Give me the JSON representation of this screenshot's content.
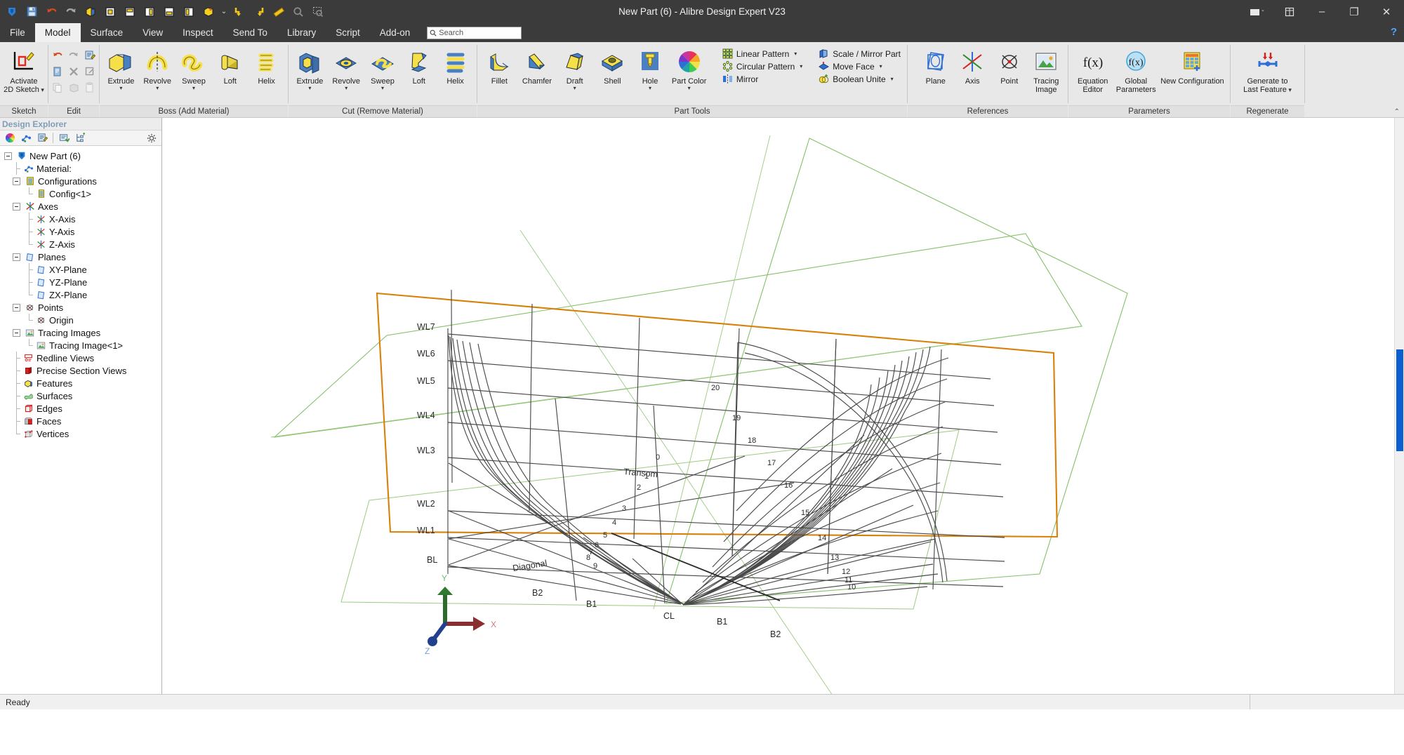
{
  "window": {
    "title": "New Part (6) - Alibre Design Expert V23",
    "controls": {
      "theme": "theme-switch",
      "restore_layout": "layout-icon",
      "minimize": "–",
      "maximize": "❐",
      "close": "✕"
    }
  },
  "quick_access": [
    {
      "name": "alibre-logo-icon",
      "glyph": "◆"
    },
    {
      "name": "save-icon",
      "glyph": "💾"
    },
    {
      "name": "undo-icon",
      "glyph": "↺"
    },
    {
      "name": "redo-icon",
      "glyph": "↻"
    },
    {
      "name": "view-iso-icon",
      "glyph": "▣"
    },
    {
      "name": "view-front-icon",
      "glyph": "▣"
    },
    {
      "name": "view-top-icon",
      "glyph": "▣"
    },
    {
      "name": "view-right-icon",
      "glyph": "▣"
    },
    {
      "name": "view-back-icon",
      "glyph": "▣"
    },
    {
      "name": "view-left-icon",
      "glyph": "▣"
    },
    {
      "name": "view-shaded-icon",
      "glyph": "▣"
    },
    {
      "name": "view-dropdown-caret",
      "glyph": "⌄"
    },
    {
      "name": "fit-in-icon",
      "glyph": "⬒"
    },
    {
      "name": "fit-out-icon",
      "glyph": "⬓"
    },
    {
      "name": "measure-icon",
      "glyph": "📏"
    },
    {
      "name": "zoom-icon",
      "glyph": "🔍"
    },
    {
      "name": "zoom-window-icon",
      "glyph": "🔎"
    }
  ],
  "menu": {
    "tabs": [
      {
        "label": "File",
        "active": false
      },
      {
        "label": "Model",
        "active": true
      },
      {
        "label": "Surface",
        "active": false
      },
      {
        "label": "View",
        "active": false
      },
      {
        "label": "Inspect",
        "active": false
      },
      {
        "label": "Send To",
        "active": false
      },
      {
        "label": "Library",
        "active": false
      },
      {
        "label": "Script",
        "active": false
      },
      {
        "label": "Add-on",
        "active": false
      }
    ],
    "search_placeholder": "Search",
    "search_value": "",
    "help_label": "?"
  },
  "ribbon": {
    "groups": [
      {
        "label": "Sketch",
        "buttons": [
          {
            "label": "Activate\n2D Sketch",
            "name": "activate-2d-sketch-button",
            "icon": "sketch-icon",
            "caret": true
          }
        ]
      },
      {
        "label": "Edit",
        "grid": [
          {
            "name": "undo-icon",
            "glyph": "↺",
            "color": "#d84a1b"
          },
          {
            "name": "redo-icon",
            "glyph": "↻",
            "color": "#a8a8a8"
          },
          {
            "name": "edit-properties-icon",
            "glyph": "▤",
            "color": "#3a6ea5"
          },
          {
            "name": "paste-special-icon",
            "glyph": "▤",
            "color": "#7fa8d4"
          },
          {
            "name": "delete-icon",
            "glyph": "✕",
            "color": "#9a9a9a"
          },
          {
            "name": "edit-definition-icon",
            "glyph": "◩",
            "color": "#9a9a9a"
          },
          {
            "name": "copy-icon",
            "glyph": "❐",
            "color": "#c8c8c8"
          },
          {
            "name": "cut-icon",
            "glyph": "◨",
            "color": "#c8c8c8"
          },
          {
            "name": "paste-icon",
            "glyph": "❒",
            "color": "#c8c8c8"
          }
        ]
      },
      {
        "label": "Boss (Add Material)",
        "buttons": [
          {
            "label": "Extrude",
            "name": "boss-extrude-button",
            "icon": "extrude-boss-icon",
            "caret": true
          },
          {
            "label": "Revolve",
            "name": "boss-revolve-button",
            "icon": "revolve-boss-icon",
            "caret": true
          },
          {
            "label": "Sweep",
            "name": "boss-sweep-button",
            "icon": "sweep-boss-icon",
            "caret": true
          },
          {
            "label": "Loft",
            "name": "boss-loft-button",
            "icon": "loft-boss-icon",
            "caret": false
          },
          {
            "label": "Helix",
            "name": "boss-helix-button",
            "icon": "helix-boss-icon",
            "caret": false
          }
        ]
      },
      {
        "label": "Cut (Remove Material)",
        "buttons": [
          {
            "label": "Extrude",
            "name": "cut-extrude-button",
            "icon": "extrude-cut-icon",
            "caret": true
          },
          {
            "label": "Revolve",
            "name": "cut-revolve-button",
            "icon": "revolve-cut-icon",
            "caret": true
          },
          {
            "label": "Sweep",
            "name": "cut-sweep-button",
            "icon": "sweep-cut-icon",
            "caret": true
          },
          {
            "label": "Loft",
            "name": "cut-loft-button",
            "icon": "loft-cut-icon",
            "caret": false
          },
          {
            "label": "Helix",
            "name": "cut-helix-button",
            "icon": "helix-cut-icon",
            "caret": false
          }
        ]
      },
      {
        "label": "Part Tools",
        "buttons": [
          {
            "label": "Fillet",
            "name": "fillet-button",
            "icon": "fillet-icon",
            "caret": false
          },
          {
            "label": "Chamfer",
            "name": "chamfer-button",
            "icon": "chamfer-icon",
            "caret": false
          },
          {
            "label": "Draft",
            "name": "draft-button",
            "icon": "draft-icon",
            "caret": true
          },
          {
            "label": "Shell",
            "name": "shell-button",
            "icon": "shell-icon",
            "caret": false
          },
          {
            "label": "Hole",
            "name": "hole-button",
            "icon": "hole-icon",
            "caret": true
          },
          {
            "label": "Part Color",
            "name": "part-color-button",
            "icon": "part-color-icon",
            "caret": true
          }
        ],
        "small_col_a": [
          {
            "label": "Linear Pattern",
            "name": "linear-pattern-button",
            "icon": "linear-pattern-icon",
            "dropdown": true
          },
          {
            "label": "Circular Pattern",
            "name": "circular-pattern-button",
            "icon": "circular-pattern-icon",
            "dropdown": true
          },
          {
            "label": "Mirror",
            "name": "mirror-button",
            "icon": "mirror-icon",
            "dropdown": false
          }
        ],
        "small_col_b": [
          {
            "label": "Scale / Mirror Part",
            "name": "scale-mirror-part-button",
            "icon": "scale-mirror-icon",
            "dropdown": false
          },
          {
            "label": "Move Face",
            "name": "move-face-button",
            "icon": "move-face-icon",
            "dropdown": true
          },
          {
            "label": "Boolean Unite",
            "name": "boolean-unite-button",
            "icon": "boolean-unite-icon",
            "dropdown": true
          }
        ]
      },
      {
        "label": "References",
        "buttons": [
          {
            "label": "Plane",
            "name": "plane-button",
            "icon": "plane-icon",
            "caret": false
          },
          {
            "label": "Axis",
            "name": "axis-button",
            "icon": "axis-icon",
            "caret": false
          },
          {
            "label": "Point",
            "name": "point-button",
            "icon": "point-icon",
            "caret": false
          },
          {
            "label": "Tracing\nImage",
            "name": "tracing-image-button",
            "icon": "tracing-image-icon",
            "caret": false
          }
        ]
      },
      {
        "label": "Parameters",
        "buttons": [
          {
            "label": "Equation\nEditor",
            "name": "equation-editor-button",
            "icon": "equation-editor-icon",
            "caret": false
          },
          {
            "label": "Global\nParameters",
            "name": "global-parameters-button",
            "icon": "global-parameters-icon",
            "caret": false
          },
          {
            "label": "New Configuration",
            "name": "new-configuration-button",
            "icon": "new-configuration-icon",
            "caret": false
          }
        ]
      },
      {
        "label": "Regenerate",
        "buttons": [
          {
            "label": "Generate to\nLast Feature",
            "name": "generate-to-last-feature-button",
            "icon": "regenerate-icon",
            "caret": true
          }
        ]
      }
    ]
  },
  "explorer": {
    "title": "Design Explorer",
    "toolbar": [
      {
        "name": "color-wheel-icon",
        "glyph": "◉"
      },
      {
        "name": "material-icon",
        "glyph": "⁂"
      },
      {
        "name": "notes-icon",
        "glyph": "▤"
      },
      {
        "name": "show-hide-icon",
        "glyph": "▣"
      },
      {
        "name": "expand-tree-icon",
        "glyph": "⊞"
      }
    ],
    "settings_icon": "gear-icon",
    "tree": [
      {
        "label": "New Part (6)",
        "depth": 0,
        "icon": "part-icon",
        "expander": true
      },
      {
        "label": "Material:",
        "depth": 1,
        "icon": "material-icon",
        "expander": false
      },
      {
        "label": "Configurations",
        "depth": 1,
        "icon": "configurations-icon",
        "expander": true
      },
      {
        "label": "Config<1>",
        "depth": 2,
        "icon": "config-icon",
        "expander": false
      },
      {
        "label": "Axes",
        "depth": 1,
        "icon": "axes-icon",
        "expander": true
      },
      {
        "label": "X-Axis",
        "depth": 2,
        "icon": "axis-icon",
        "expander": false
      },
      {
        "label": "Y-Axis",
        "depth": 2,
        "icon": "axis-icon",
        "expander": false
      },
      {
        "label": "Z-Axis",
        "depth": 2,
        "icon": "axis-icon",
        "expander": false
      },
      {
        "label": "Planes",
        "depth": 1,
        "icon": "plane-icon",
        "expander": true
      },
      {
        "label": "XY-Plane",
        "depth": 2,
        "icon": "plane-icon",
        "expander": false
      },
      {
        "label": "YZ-Plane",
        "depth": 2,
        "icon": "plane-icon",
        "expander": false
      },
      {
        "label": "ZX-Plane",
        "depth": 2,
        "icon": "plane-icon",
        "expander": false
      },
      {
        "label": "Points",
        "depth": 1,
        "icon": "point-icon",
        "expander": true
      },
      {
        "label": "Origin",
        "depth": 2,
        "icon": "point-icon",
        "expander": false
      },
      {
        "label": "Tracing Images",
        "depth": 1,
        "icon": "tracing-image-icon",
        "expander": true
      },
      {
        "label": "Tracing Image<1>",
        "depth": 2,
        "icon": "tracing-image-icon",
        "expander": false
      },
      {
        "label": "Redline Views",
        "depth": 1,
        "icon": "redline-icon",
        "expander": false
      },
      {
        "label": "Precise Section Views",
        "depth": 1,
        "icon": "section-view-icon",
        "expander": false
      },
      {
        "label": "Features",
        "depth": 1,
        "icon": "features-icon",
        "expander": false
      },
      {
        "label": "Surfaces",
        "depth": 1,
        "icon": "surfaces-icon",
        "expander": false
      },
      {
        "label": "Edges",
        "depth": 1,
        "icon": "edges-icon",
        "expander": false
      },
      {
        "label": "Faces",
        "depth": 1,
        "icon": "faces-icon",
        "expander": false
      },
      {
        "label": "Vertices",
        "depth": 1,
        "icon": "vertices-icon",
        "expander": false
      }
    ]
  },
  "viewport": {
    "tracing_image_name": "boat-hull-lines-plan",
    "colors": {
      "plane_boundary": "#d98008",
      "reference_plane": "#86c06a",
      "drawing_line": "#444444",
      "axis_x": "#993333",
      "axis_y": "#1f5c1f",
      "axis_z": "#1f3f8f"
    },
    "waterline_labels": [
      "WL7",
      "WL6",
      "WL5",
      "WL4",
      "WL3",
      "WL2",
      "WL1",
      "BL"
    ],
    "buttock_labels": [
      "B2",
      "B1",
      "CL",
      "B1",
      "B2"
    ],
    "annotations": [
      "Transom",
      "Diagonal"
    ],
    "station_numbers_left": [
      "0",
      "1",
      "2",
      "3",
      "4",
      "5",
      "6",
      "7",
      "8",
      "9"
    ],
    "station_numbers_right": [
      "20",
      "19",
      "18",
      "17",
      "16",
      "15",
      "14",
      "13",
      "12",
      "11",
      "10"
    ],
    "triad": {
      "x": "X",
      "y": "Y",
      "z": "Z"
    }
  },
  "status": {
    "message": "Ready"
  }
}
